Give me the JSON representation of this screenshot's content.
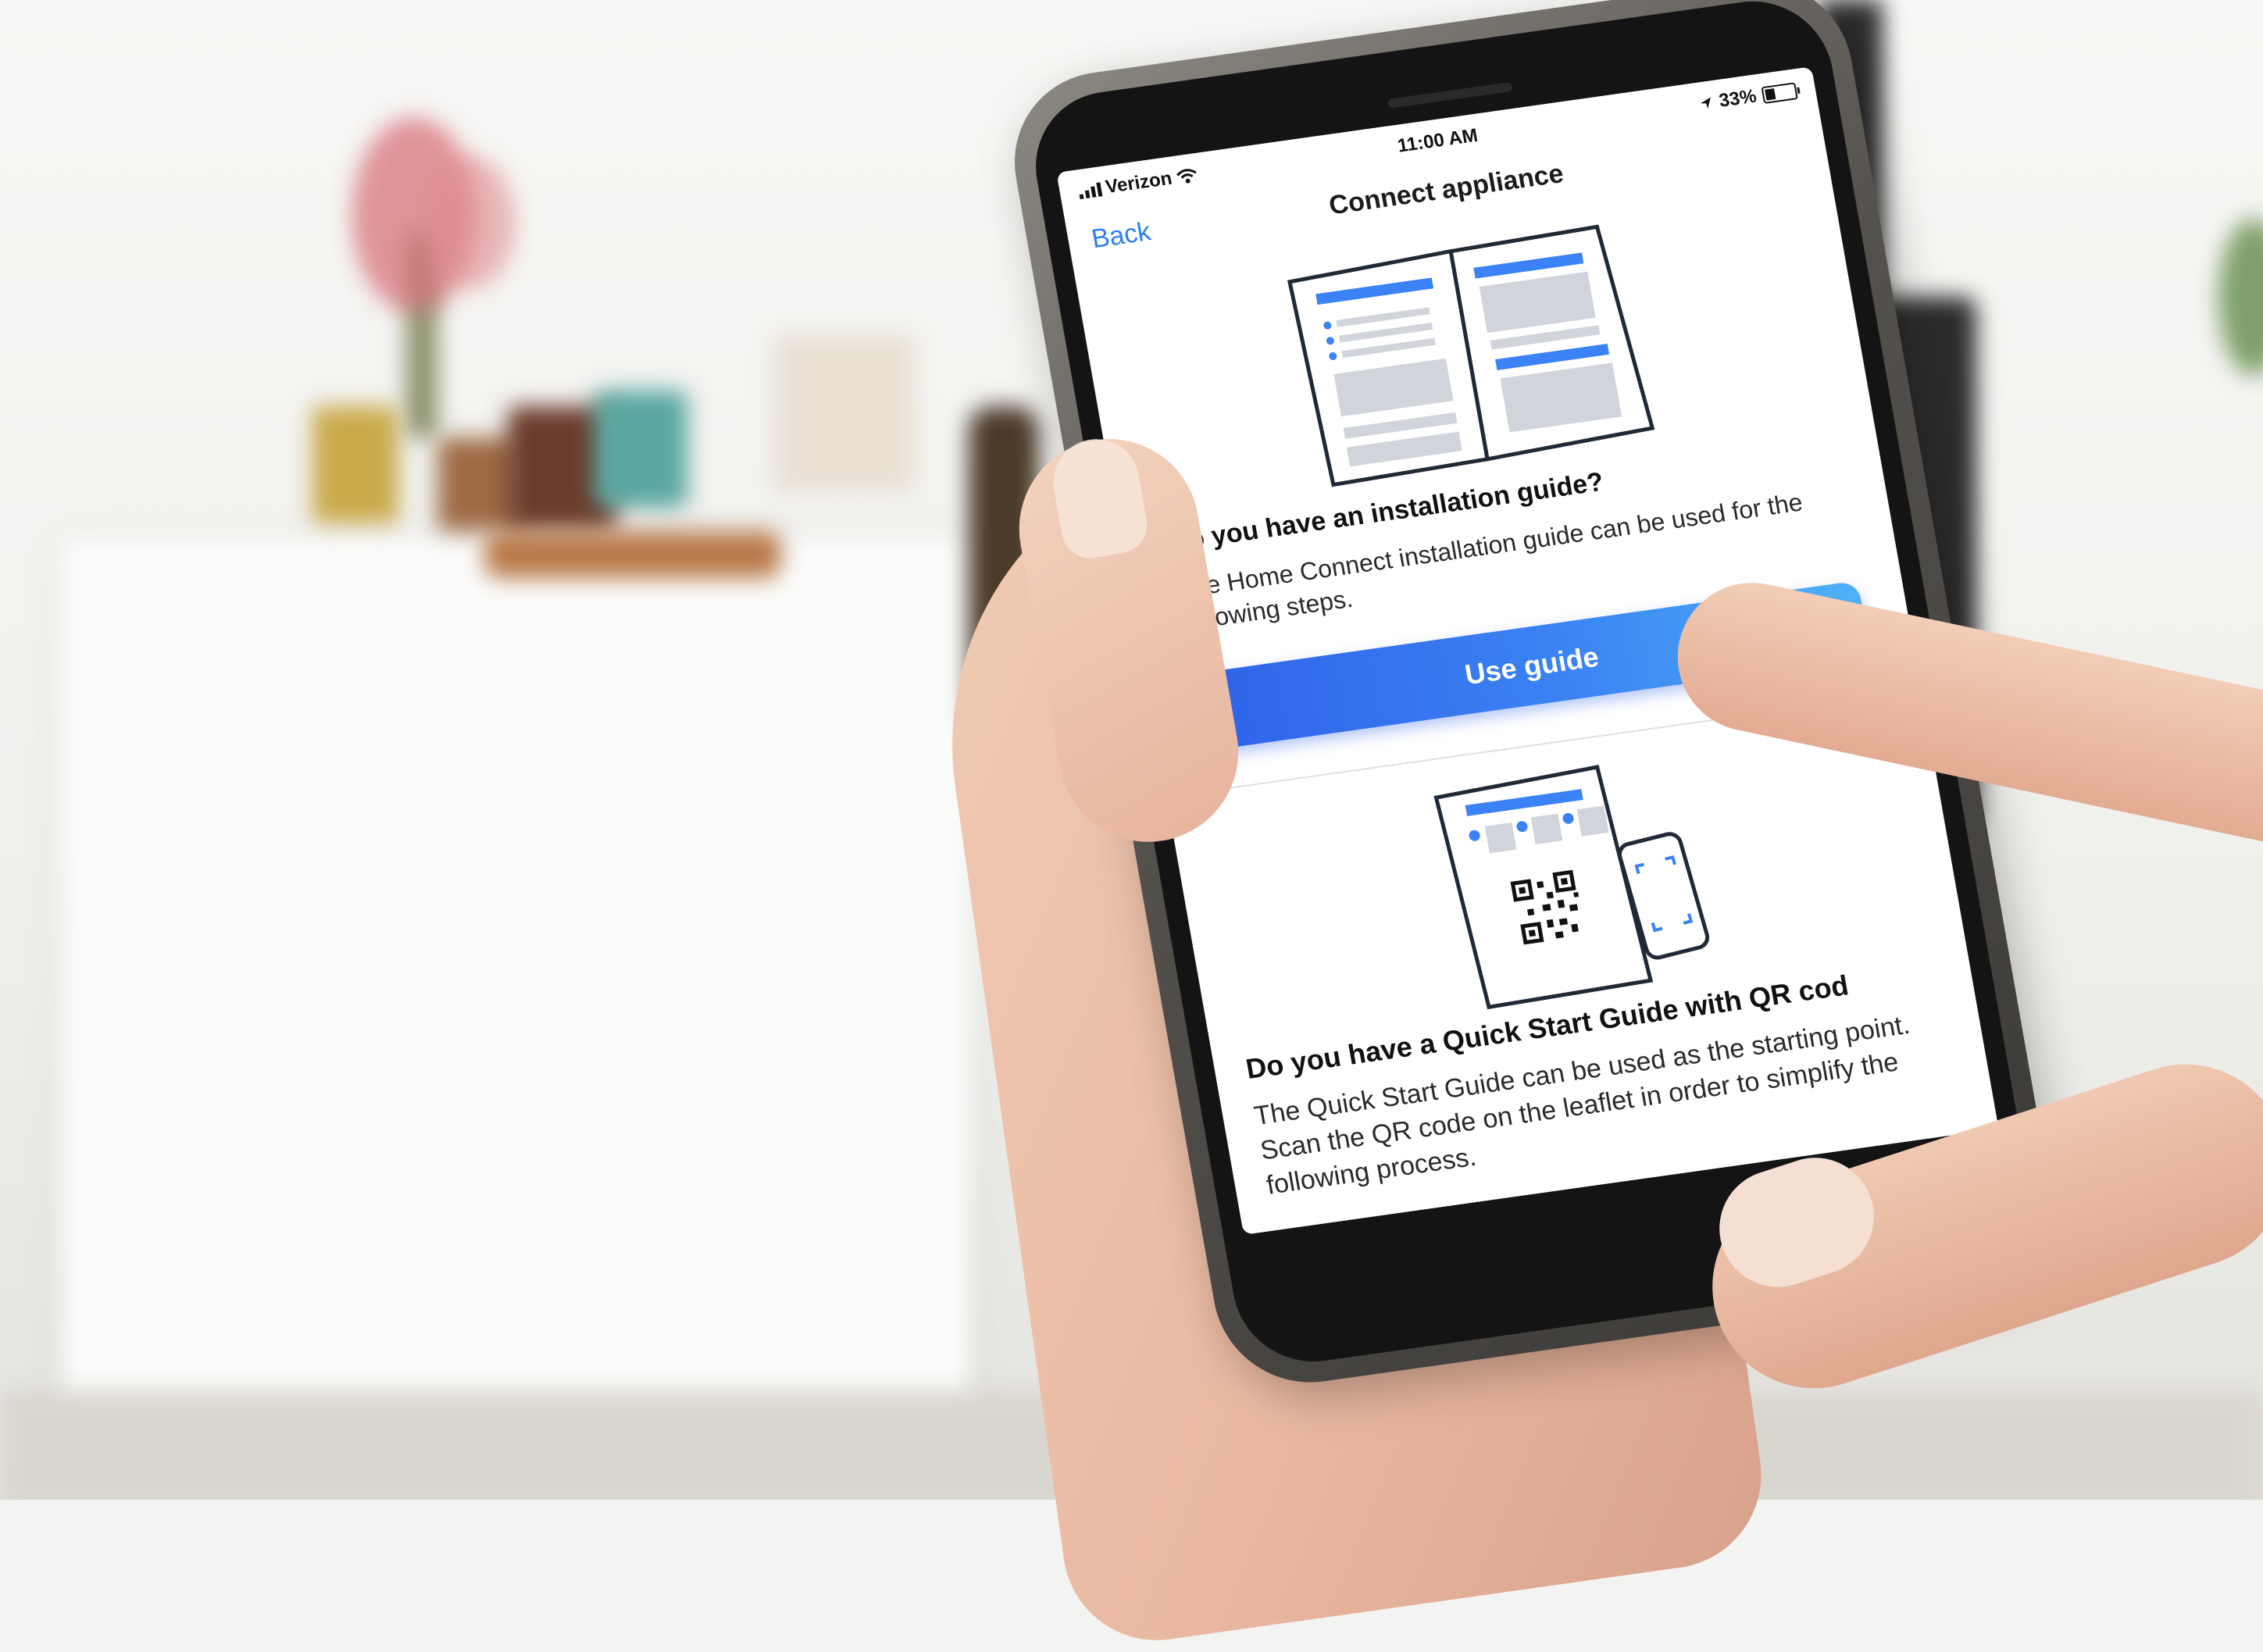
{
  "status_bar": {
    "carrier": "Verizon",
    "time": "11:00 AM",
    "battery": "33%",
    "battery_level": 0.33
  },
  "nav": {
    "back_label": "Back",
    "title": "Connect appliance"
  },
  "installation_guide": {
    "heading": "Do you have an installation guide?",
    "body": "The Home Connect installation guide can be used for the following steps.",
    "button_label": "Use guide"
  },
  "quick_start": {
    "heading": "Do you have a Quick Start Guide with QR cod",
    "body": "The Quick Start Guide can be used as the starting point. Scan the QR code on the leaflet in order to simplify the following process."
  },
  "colors": {
    "accent": "#2d7ff0",
    "button_start": "#2f62e8",
    "button_end": "#4fb1f7",
    "illustration_blue": "#3b82f6",
    "illustration_gray": "#d1d5db"
  },
  "icons": [
    "signal-icon",
    "wifi-icon",
    "location-icon",
    "battery-icon",
    "guide-book-icon",
    "qr-leaflet-icon"
  ]
}
